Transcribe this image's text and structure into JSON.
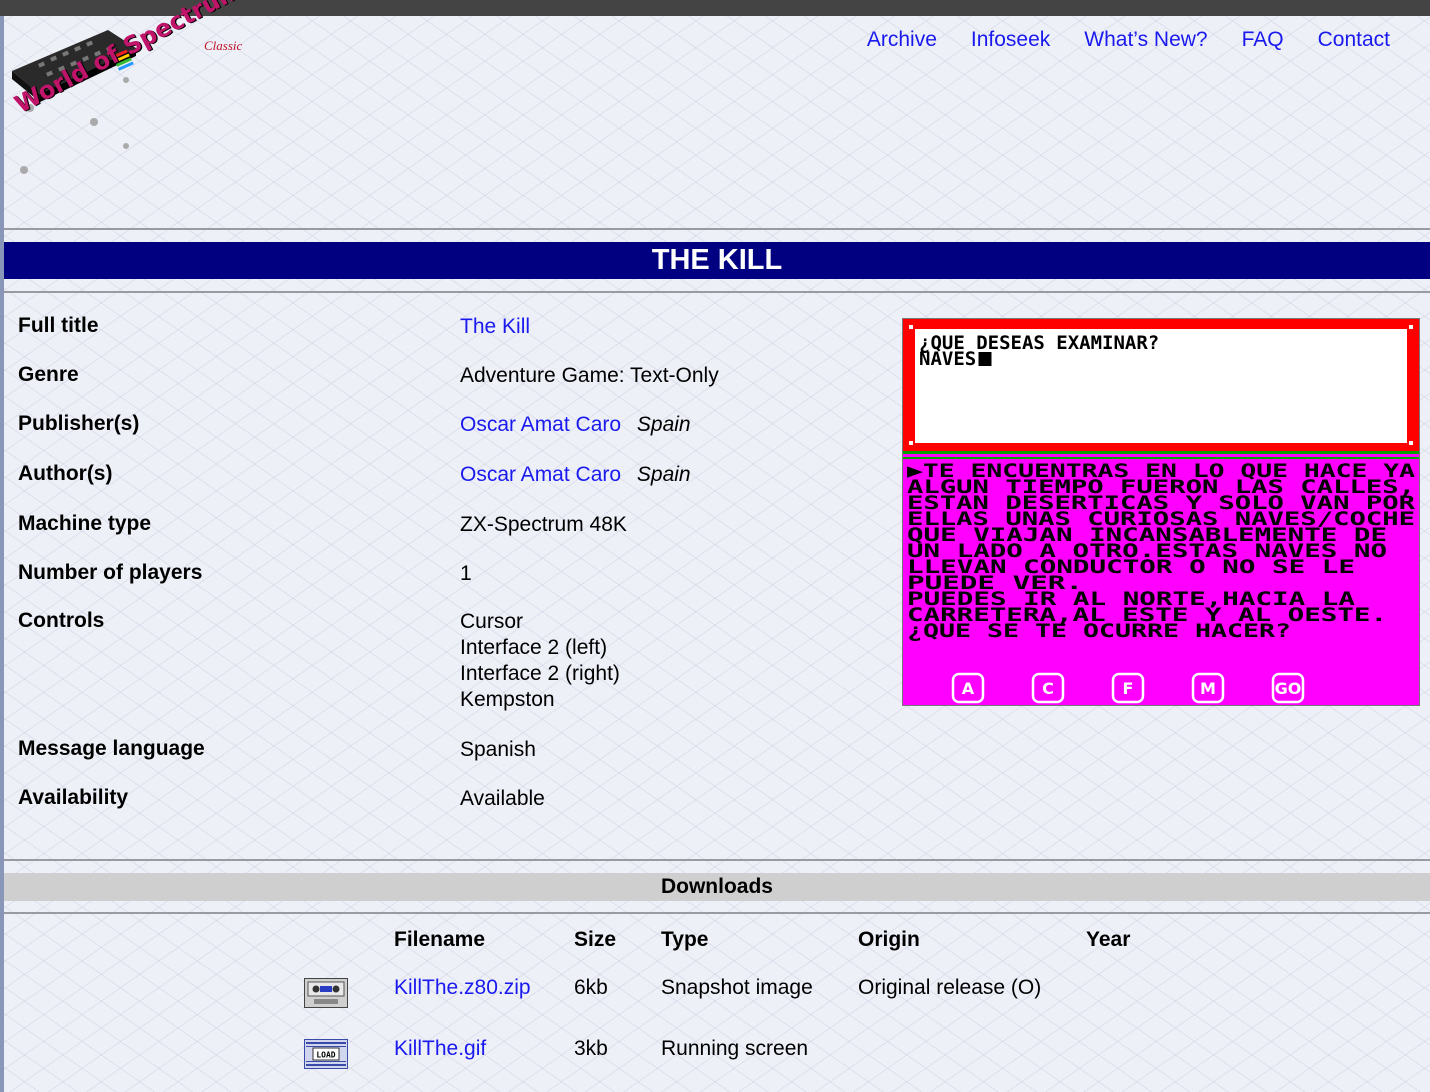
{
  "site": {
    "logo_text": "World of Spectrum",
    "logo_badge": "Classic"
  },
  "nav": [
    "Archive",
    "Infoseek",
    "What’s New?",
    "FAQ",
    "Contact"
  ],
  "page_title": "THE KILL",
  "info": {
    "full_title_label": "Full title",
    "full_title": "The Kill",
    "genre_label": "Genre",
    "genre": "Adventure Game: Text-Only",
    "publisher_label": "Publisher(s)",
    "publisher": "Oscar Amat Caro",
    "publisher_country": "Spain",
    "author_label": "Author(s)",
    "author": "Oscar Amat Caro",
    "author_country": "Spain",
    "machine_label": "Machine type",
    "machine": "ZX-Spectrum 48K",
    "players_label": "Number of players",
    "players": "1",
    "controls_label": "Controls",
    "controls": [
      "Cursor",
      "Interface 2 (left)",
      "Interface 2 (right)",
      "Kempston"
    ],
    "language_label": "Message language",
    "language": "Spanish",
    "availability_label": "Availability",
    "availability": "Available"
  },
  "screenshot": {
    "prompt_lines": [
      "¿QUE DESEAS EXAMINAR?",
      "NAVES"
    ],
    "text_lines": [
      "▶TE ENCUENTRAS EN LO QUE HACE YA",
      " ALGUN TIEMPO FUERON LAS CALLES,",
      " ESTAN DESERTICAS Y SOLO VAN POR",
      " ELLAS UNAS CURIOSAS NAVES/COCHE",
      " QUE VIAJAN INCANSABLEMENTE DE",
      " UN LADO A OTRO.ESTAS NAVES NO",
      " LLEVAN CONDUCTOR O NO SE LE",
      " PUEDE VER.",
      " PUEDES IR AL NORTE,HACIA LA",
      " CARRETERA,AL ESTE Y AL OESTE.",
      "¿QUE SE TE OCURRE HACER?"
    ],
    "buttons": [
      "A",
      "C",
      "F",
      "M",
      "GO"
    ],
    "colors": {
      "border": "#ff0000",
      "panel": "#ff00ff",
      "text": "#000000"
    }
  },
  "downloads": {
    "heading": "Downloads",
    "columns": [
      "Filename",
      "Size",
      "Type",
      "Origin",
      "Year"
    ],
    "rows": [
      {
        "icon": "tape-icon",
        "filename": "KillThe.z80.zip",
        "size": "6kb",
        "type": "Snapshot image",
        "origin": "Original release (O)",
        "year": ""
      },
      {
        "icon": "load-screen-icon",
        "filename": "KillThe.gif",
        "size": "3kb",
        "type": "Running screen",
        "origin": "",
        "year": ""
      }
    ]
  },
  "colors": {
    "title_bar": "#000080",
    "link": "#1a1aee",
    "downloads_bar": "#cfcfcf"
  }
}
